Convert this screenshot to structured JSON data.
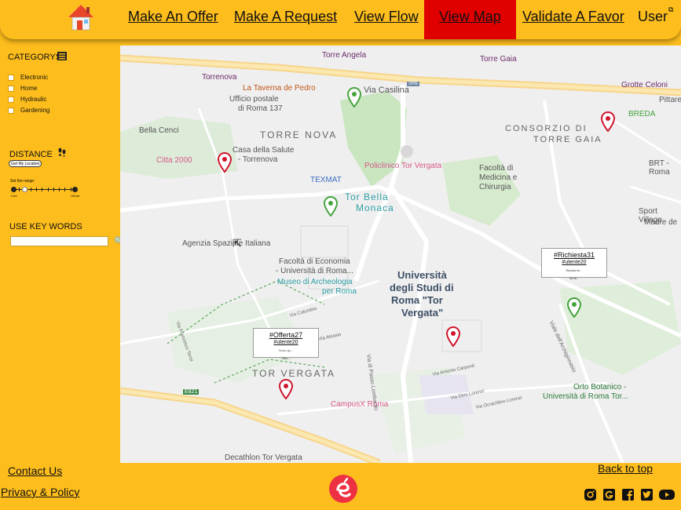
{
  "nav": {
    "items": [
      {
        "label": "Make An Offer"
      },
      {
        "label": "Make A Request"
      },
      {
        "label": "View Flow"
      },
      {
        "label": "View Map",
        "active": true
      },
      {
        "label": "Validate A Favor"
      },
      {
        "label": "User"
      }
    ]
  },
  "sidebar": {
    "categories_title": "CATEGORYS",
    "categories": [
      "Electronic",
      "Home",
      "Hydraulic",
      "Gardening"
    ],
    "distance_title": "DISTANCE",
    "location_button": "Get My Location",
    "range_label": "Set the range:",
    "range_min": "0 km",
    "range_max": "100 km",
    "range_value_fraction": 0.18,
    "keywords_title": "USE KEY WORDS",
    "keywords_value": "",
    "help_glyph": "?"
  },
  "map": {
    "labels": {
      "t1": "Torre Angela",
      "t2": "Torre Gaia",
      "t3": "Torrenova",
      "t4": "La Taverna de Pedro",
      "t5": "Via Casilina",
      "t6": "SR6",
      "t7": "Ufficio postale",
      "t8": "di Roma 137",
      "t9": "TORRE NOVA",
      "t10": "Bella Cenci",
      "t11": "Casa della Salute",
      "t12": "- Torrenova",
      "t13": "Citta 2000",
      "t14": "TEXMAT",
      "t15": "Tor Bella",
      "t16": "Monaca",
      "t17": "Policlinico Tor Vergata",
      "t18": "CONSORZIO DI",
      "t19": "TORRE GAIA",
      "t20": "Grotte Celoni",
      "t21": "Pittarello",
      "t22": "BREDA",
      "t23": "BRT - Roma",
      "t24": "Facoltà di",
      "t25": "Medicina e",
      "t26": "Chirurgia",
      "t27": "Agenzia Spaziale Italiana",
      "t28": "Sport Village",
      "t29": "Madre de",
      "t30": "Facoltà di Economia",
      "t31": "- Università di Roma...",
      "t32": "Museo di Archeologia",
      "t33": "per Roma",
      "t34": "Università",
      "t35": "degli Studi di",
      "t36": "Roma \"Tor",
      "t37": "Vergata\"",
      "t38": "TOR VERGATA",
      "t39": "Orto Botanico -",
      "t40": "Università di Roma Tor...",
      "t41": "CampusX Roma",
      "t42": "Decathlon Tor Vergata",
      "t43": "E821",
      "t44": "Via di Passo Lombardo",
      "t45": "Viale dell'Archiginnasio",
      "t46": "Via Francesco Tensi",
      "t47": "Via Columbia",
      "t48": "Via Alessio",
      "t49": "Via Antonio Carpené",
      "t50": "Via Dino Lorenzi",
      "t51": "Via Ocrachlino Lorenzi"
    },
    "popups": [
      {
        "title": "#Offerta27",
        "user": "#utente20",
        "snippet": "Sono qu...",
        "snippet2": "offro..."
      },
      {
        "title": "#Richiesta31",
        "user": "#utente20",
        "snippet": "Ripararne...",
        "snippet2": "fornit..."
      }
    ],
    "colors": {
      "offer_pin": "#d0142c",
      "request_pin": "#45a33d"
    }
  },
  "footer": {
    "contact": "Contact Us",
    "privacy": "Privacy & Policy",
    "back": "Back to top",
    "socials": [
      "instagram-icon",
      "google-icon",
      "facebook-icon",
      "twitter-icon",
      "youtube-icon"
    ]
  }
}
